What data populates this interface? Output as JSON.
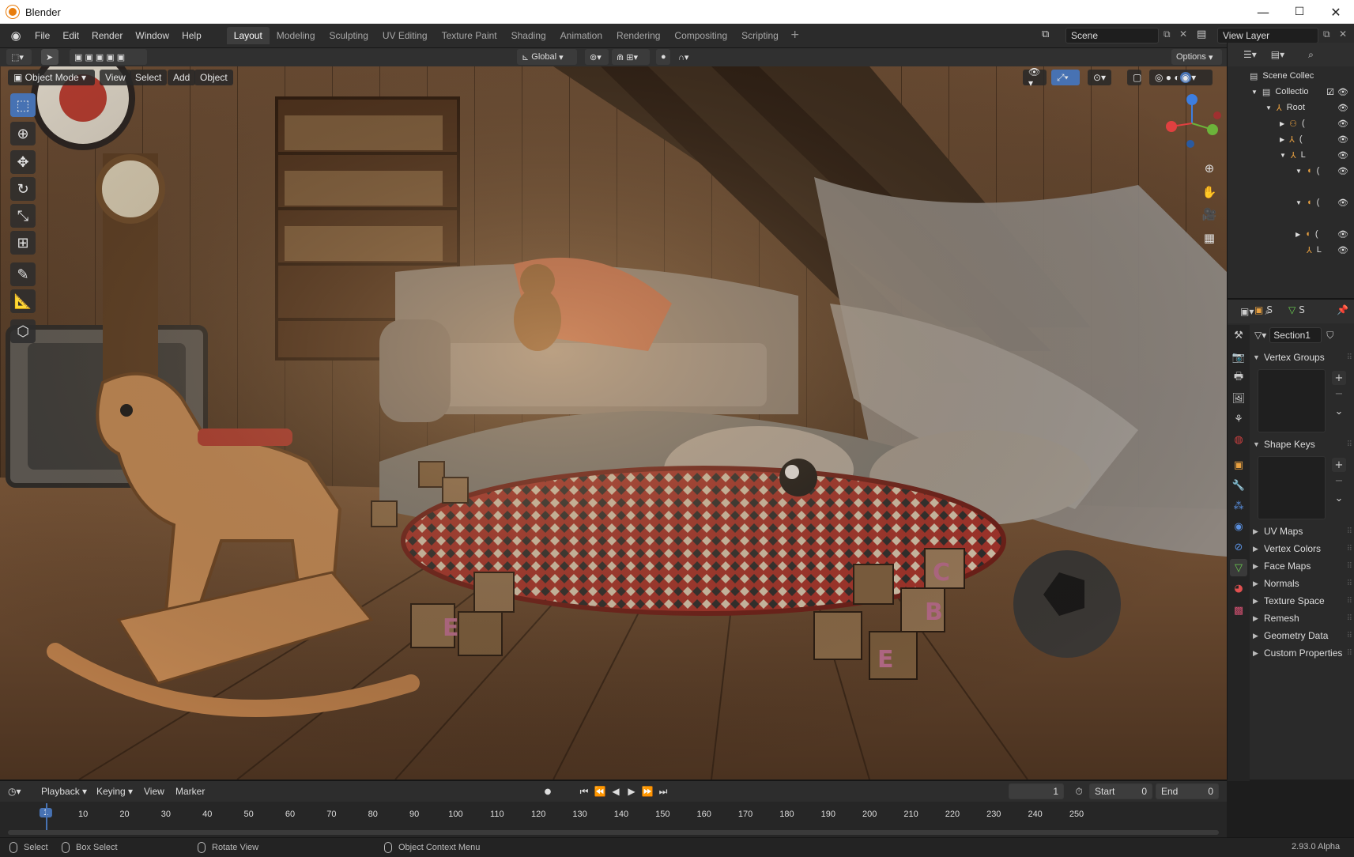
{
  "window": {
    "title": "Blender",
    "minimize": "—",
    "maximize": "☐",
    "close": "✕"
  },
  "menubar": {
    "items": [
      "File",
      "Edit",
      "Render",
      "Window",
      "Help"
    ],
    "workspaces": [
      "Layout",
      "Modeling",
      "Sculpting",
      "UV Editing",
      "Texture Paint",
      "Shading",
      "Animation",
      "Rendering",
      "Compositing",
      "Scripting"
    ],
    "active_workspace": "Layout",
    "add_tab": "+",
    "scene": "Scene",
    "view_layer": "View Layer"
  },
  "viewport_header": {
    "transform_orientation": "Global",
    "options": "Options"
  },
  "viewport_menu": {
    "mode": "Object Mode",
    "items": [
      "View",
      "Select",
      "Add",
      "Object"
    ]
  },
  "outliner": {
    "rows": [
      {
        "label": "Scene Collec",
        "icon": "scene-collection-icon"
      },
      {
        "label": "Collectio",
        "icon": "collection-icon"
      },
      {
        "label": "Root",
        "icon": "armature-icon"
      },
      {
        "label": "(",
        "icon": "group-icon"
      },
      {
        "label": "(",
        "icon": "armature-icon"
      },
      {
        "label": "L",
        "icon": "armature-icon"
      },
      {
        "label": "(",
        "icon": "mesh-icon"
      },
      {
        "label": "(",
        "icon": "mesh-icon"
      },
      {
        "label": "(",
        "icon": "mesh-icon"
      },
      {
        "label": "L",
        "icon": "armature-icon"
      }
    ]
  },
  "properties": {
    "header_left": "S",
    "header_right": "S",
    "mesh_name": "Section1",
    "sections": [
      {
        "label": "Vertex Groups",
        "open": true
      },
      {
        "label": "Shape Keys",
        "open": true
      },
      {
        "label": "UV Maps",
        "open": false
      },
      {
        "label": "Vertex Colors",
        "open": false
      },
      {
        "label": "Face Maps",
        "open": false
      },
      {
        "label": "Normals",
        "open": false
      },
      {
        "label": "Texture Space",
        "open": false
      },
      {
        "label": "Remesh",
        "open": false
      },
      {
        "label": "Geometry Data",
        "open": false
      },
      {
        "label": "Custom Properties",
        "open": false
      }
    ]
  },
  "timeline": {
    "menus": [
      "Playback",
      "Keying",
      "View",
      "Marker"
    ],
    "current_frame": "1",
    "start_label": "Start",
    "start_value": "0",
    "end_label": "End",
    "end_value": "0",
    "ticks": [
      "1",
      "10",
      "20",
      "30",
      "40",
      "50",
      "60",
      "70",
      "80",
      "90",
      "100",
      "110",
      "120",
      "130",
      "140",
      "150",
      "160",
      "170",
      "180",
      "190",
      "200",
      "210",
      "220",
      "230",
      "240",
      "250"
    ]
  },
  "statusbar": {
    "select": "Select",
    "box_select": "Box Select",
    "rotate_view": "Rotate View",
    "context_menu": "Object Context Menu",
    "version": "2.93.0 Alpha"
  },
  "colors": {
    "accent": "#4772b3",
    "blender_orange": "#e87d0d"
  }
}
